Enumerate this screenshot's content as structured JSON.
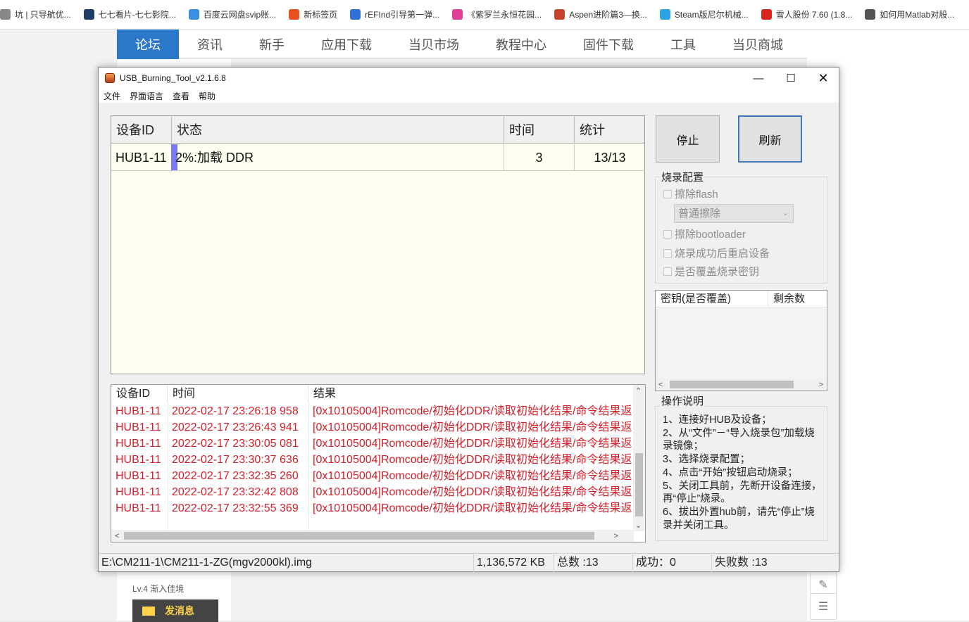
{
  "browser": {
    "bookmarks": [
      {
        "label": "坑 | 只导航优...",
        "icon": "doc-icon",
        "color": "#888888"
      },
      {
        "label": "七七看片-七七影院...",
        "icon": "film-icon",
        "color": "#1f3d66"
      },
      {
        "label": "百度云网盘svip账...",
        "icon": "baidu-cloud-icon",
        "color": "#3b8ee0"
      },
      {
        "label": "新标签页",
        "icon": "infinity-icon",
        "color": "#e8501e"
      },
      {
        "label": "rEFInd引导第一弹...",
        "icon": "paw-icon",
        "color": "#2e6fd9"
      },
      {
        "label": "《紫罗兰永恒花园...",
        "icon": "colorful-tiles-icon",
        "color": "#e0409a"
      },
      {
        "label": "Aspen进阶篇3—换...",
        "icon": "jian-icon",
        "color": "#c8452c"
      },
      {
        "label": "Steam版尼尔机械...",
        "icon": "tv-icon",
        "color": "#2aa3e6"
      },
      {
        "label": "雪人股份 7.60 (1.8...",
        "icon": "money-icon",
        "color": "#d9261c"
      },
      {
        "label": "如何用Matlab对股...",
        "icon": "globe-icon",
        "color": "#555555"
      }
    ]
  },
  "site": {
    "nav": [
      "论坛",
      "资讯",
      "新手",
      "应用下载",
      "当贝市场",
      "教程中心",
      "固件下载",
      "工具",
      "当贝商城"
    ],
    "active_nav": "论坛",
    "user_level": "Lv.4 渐入佳境",
    "send_message": "发消息",
    "accent": "#2c78c8"
  },
  "window": {
    "title": "USB_Burning_Tool_v2.1.6.8",
    "menu": [
      "文件",
      "界面语言",
      "查看",
      "帮助"
    ]
  },
  "device_list": {
    "columns": [
      "设备ID",
      "状态",
      "时间",
      "统计"
    ],
    "rows": [
      {
        "device_id": "HUB1-11",
        "progress_pct": 2,
        "status": "2%:加载 DDR",
        "time": "3",
        "stats": "13/13"
      }
    ]
  },
  "buttons": {
    "stop": "停止",
    "refresh": "刷新"
  },
  "burn_config": {
    "title": "烧录配置",
    "erase_flash": "擦除flash",
    "erase_mode": "普通擦除",
    "erase_bootloader": "擦除bootloader",
    "reboot_after": "烧录成功后重启设备",
    "overwrite_key": "是否覆盖烧录密钥"
  },
  "key_list": {
    "columns": [
      "密钥(是否覆盖)",
      "剩余数"
    ]
  },
  "instructions": {
    "title": "操作说明",
    "lines": [
      "1、连接好HUB及设备；",
      "2、从“文件”－“导入烧录包”加载烧录镜像；",
      "3、选择烧录配置；",
      "4、点击“开始”按钮启动烧录；",
      "5、关闭工具前，先断开设备连接，再“停止”烧录。",
      "6、拔出外置hub前，请先“停止”烧录并关闭工具。"
    ]
  },
  "log": {
    "columns": [
      "设备ID",
      "时间",
      "结果"
    ],
    "rows": [
      {
        "device": "HUB1-11",
        "time": "2022-02-17 23:26:18 958",
        "result": "[0x10105004]Romcode/初始化DDR/读取初始化结果/命令结果返"
      },
      {
        "device": "HUB1-11",
        "time": "2022-02-17 23:26:43 941",
        "result": "[0x10105004]Romcode/初始化DDR/读取初始化结果/命令结果返"
      },
      {
        "device": "HUB1-11",
        "time": "2022-02-17 23:30:05 081",
        "result": "[0x10105004]Romcode/初始化DDR/读取初始化结果/命令结果返"
      },
      {
        "device": "HUB1-11",
        "time": "2022-02-17 23:30:37 636",
        "result": "[0x10105004]Romcode/初始化DDR/读取初始化结果/命令结果返"
      },
      {
        "device": "HUB1-11",
        "time": "2022-02-17 23:32:35 260",
        "result": "[0x10105004]Romcode/初始化DDR/读取初始化结果/命令结果返"
      },
      {
        "device": "HUB1-11",
        "time": "2022-02-17 23:32:42 808",
        "result": "[0x10105004]Romcode/初始化DDR/读取初始化结果/命令结果返"
      },
      {
        "device": "HUB1-11",
        "time": "2022-02-17 23:32:55 369",
        "result": "[0x10105004]Romcode/初始化DDR/读取初始化结果/命令结果返"
      }
    ],
    "error_color": "#d0202a"
  },
  "statusbar": {
    "file": "E:\\CM211-1\\CM211-1-ZG(mgv2000kl).img",
    "size": "1,136,572 KB",
    "total": "总数 :13",
    "success": "成功：0",
    "fail": "失败数 :13"
  }
}
